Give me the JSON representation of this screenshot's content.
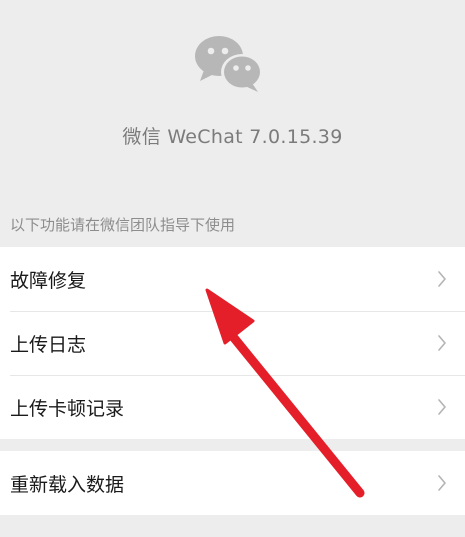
{
  "app": {
    "version_text": "微信 WeChat 7.0.15.39",
    "logo_icon": "wechat-logo-icon"
  },
  "note": {
    "text": "以下功能请在微信团队指导下使用"
  },
  "menu": {
    "group_1": [
      {
        "label": "故障修复"
      },
      {
        "label": "上传日志"
      },
      {
        "label": "上传卡顿记录"
      }
    ],
    "group_2": [
      {
        "label": "重新载入数据"
      }
    ]
  },
  "icons": {
    "chevron": "chevron-right-icon"
  },
  "annotation": {
    "arrow_color": "#e41f2a"
  }
}
